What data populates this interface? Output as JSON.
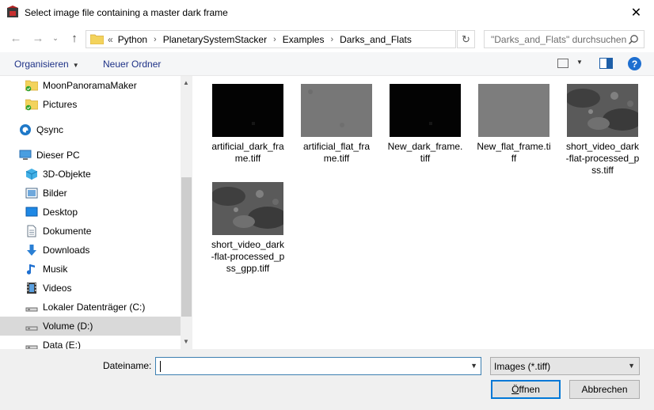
{
  "window": {
    "title": "Select image file containing a master dark frame",
    "close_glyph": "✕"
  },
  "nav": {
    "back_glyph": "←",
    "forward_glyph": "→",
    "recent_glyph": "⌄",
    "up_glyph": "↑",
    "breadcrumb_prefix": "«",
    "breadcrumbs": [
      "Python",
      "PlanetarySystemStacker",
      "Examples",
      "Darks_and_Flats"
    ],
    "crumb_separator": "›",
    "refresh_glyph": "↻",
    "search_placeholder": "\"Darks_and_Flats\" durchsuchen"
  },
  "toolbar": {
    "organize_label": "Organisieren",
    "new_folder_label": "Neuer Ordner",
    "help_glyph": "?"
  },
  "sidebar": {
    "items": [
      {
        "label": "MoonPanoramaMaker",
        "icon": "folder-sync-icon"
      },
      {
        "label": "Pictures",
        "icon": "folder-sync-icon"
      },
      {
        "label": "Qsync",
        "icon": "qsync-icon"
      },
      {
        "label": "Dieser PC",
        "icon": "computer-icon"
      },
      {
        "label": "3D-Objekte",
        "icon": "cube-icon"
      },
      {
        "label": "Bilder",
        "icon": "pictures-icon"
      },
      {
        "label": "Desktop",
        "icon": "desktop-icon"
      },
      {
        "label": "Dokumente",
        "icon": "documents-icon"
      },
      {
        "label": "Downloads",
        "icon": "downloads-icon"
      },
      {
        "label": "Musik",
        "icon": "music-icon"
      },
      {
        "label": "Videos",
        "icon": "videos-icon"
      },
      {
        "label": "Lokaler Datenträger (C:)",
        "icon": "drive-icon"
      },
      {
        "label": "Volume (D:)",
        "icon": "drive-icon",
        "selected": true
      },
      {
        "label": "Data (E:)",
        "icon": "drive-icon"
      }
    ]
  },
  "files": [
    {
      "name": "artificial_dark_frame.tiff",
      "thumb": "dark"
    },
    {
      "name": "artificial_flat_frame.tiff",
      "thumb": "flat"
    },
    {
      "name": "New_dark_frame.tiff",
      "thumb": "dark"
    },
    {
      "name": "New_flat_frame.tiff",
      "thumb": "flat-plain"
    },
    {
      "name": "short_video_dark-flat-processed_pss.tiff",
      "thumb": "moon"
    },
    {
      "name": "short_video_dark-flat-processed_pss_gpp.tiff",
      "thumb": "moon"
    }
  ],
  "footer": {
    "filename_label": "Dateiname:",
    "filename_value": "",
    "filter_value": "Images (*.tiff)",
    "open_label": "Öffnen",
    "cancel_label": "Abbrechen"
  },
  "colors": {
    "accent": "#0078d7",
    "link_text": "#1e3287",
    "selected_bg": "#d9d9d9"
  }
}
